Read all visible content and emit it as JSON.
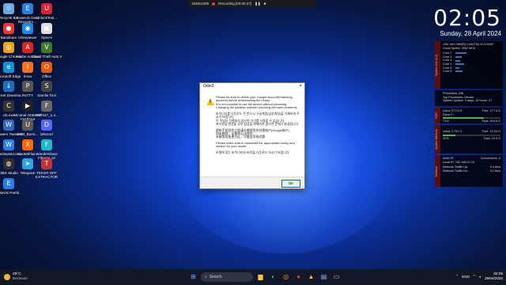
{
  "recording_bar": {
    "resolution": "1920x1080",
    "status": "Recording [00:00:47]"
  },
  "clock": {
    "time": "02:05",
    "date": "Sunday, 28 April 2024"
  },
  "desktop_icons": [
    {
      "label": "Recycle Bin",
      "icon": "recycle-bin-icon",
      "color": "#6aa8e0",
      "glyph": "♲"
    },
    {
      "label": "EaseUS Data Recovery ...",
      "icon": "easeus-icon",
      "color": "#2a7de1",
      "glyph": "E"
    },
    {
      "label": "UnlockTool...",
      "icon": "unlocktool-icon",
      "color": "#d23",
      "glyph": "U"
    },
    {
      "label": "Bandicam",
      "icon": "bandicam-icon",
      "color": "#e33",
      "glyph": "●"
    },
    {
      "label": "UltraViewer",
      "icon": "ultraviewer-icon",
      "color": "#1e88e5",
      "glyph": "◉"
    },
    {
      "label": "OpenV",
      "icon": "openv-icon",
      "color": "#ddd",
      "glyph": "▣"
    },
    {
      "label": "Google Chrome",
      "icon": "chrome-icon",
      "color": "#e9a21b",
      "glyph": "◎"
    },
    {
      "label": "Adobe Acrobat",
      "icon": "acrobat-icon",
      "color": "#d9221c",
      "glyph": "A"
    },
    {
      "label": "Grand Theft Auto V",
      "icon": "gta-icon",
      "color": "#3d7a2e",
      "glyph": "V"
    },
    {
      "label": "Microsoft Edge",
      "icon": "edge-icon",
      "color": "#1493d6",
      "glyph": "e"
    },
    {
      "label": "Imou",
      "icon": "imou-icon",
      "color": "#f36f21",
      "glyph": "i"
    },
    {
      "label": "Office",
      "icon": "office-icon",
      "color": "#e8590c",
      "glyph": "O"
    },
    {
      "label": "Internet Downloa...",
      "icon": "idm-icon",
      "color": "#1d6fb8",
      "glyph": "↓"
    },
    {
      "label": "PuTTY",
      "icon": "putty-icon",
      "color": "#555",
      "glyph": "P"
    },
    {
      "label": "Samfw Tool",
      "icon": "samfw-icon",
      "color": "#444",
      "glyph": "S"
    },
    {
      "label": "crk.exe",
      "icon": "crk-icon",
      "color": "#333",
      "glyph": "C"
    },
    {
      "label": "Minimal ADB and Fastboot",
      "icon": "adb-icon",
      "color": "#222",
      "glyph": "▶"
    },
    {
      "label": "FRP247_1.4...",
      "icon": "frp-icon",
      "color": "#666",
      "glyph": "F"
    },
    {
      "label": "Winaero Tweaker",
      "icon": "winaero-icon",
      "color": "#3568b8",
      "glyph": "W"
    },
    {
      "label": "USB_Burni...",
      "icon": "usb-icon",
      "color": "#5a5a5a",
      "glyph": "U"
    },
    {
      "label": "Discord",
      "icon": "discord-icon",
      "color": "#5865f2",
      "glyph": "D"
    },
    {
      "label": "windows64.exe",
      "icon": "windows-exe-icon",
      "color": "#2a7de1",
      "glyph": "W"
    },
    {
      "label": "XiaoMiFlas...",
      "icon": "xiaomi-icon",
      "color": "#ff6700",
      "glyph": "X"
    },
    {
      "label": "Wondershare Filmora 13",
      "icon": "filmora-icon",
      "color": "#1fb9c9",
      "glyph": "F"
    },
    {
      "label": "OBS Studio",
      "icon": "obs-icon",
      "color": "#302e31",
      "glyph": "◍"
    },
    {
      "label": "Telegram",
      "icon": "telegram-icon",
      "color": "#2aa3df",
      "glyph": "➤"
    },
    {
      "label": "TEKSR OFF EXTRACTOR",
      "icon": "teksr-icon",
      "color": "#b33",
      "glyph": "T"
    },
    {
      "label": "EaseUS Partiti...",
      "icon": "easeus-partition-icon",
      "color": "#2a7de1",
      "glyph": "E"
    }
  ],
  "system_panel": {
    "header_tab": "System Info (4.2)",
    "cpu_name": "12th Gen Intel(R) Core(TM) i5-12400F",
    "clock_speed": "Clock Speed: 2500 MHz",
    "cores": [
      "Core 1",
      "Core 2",
      "Core 3",
      "Core 4",
      "Core 5",
      "Core 6"
    ],
    "core_loads": [
      0.35,
      0.2,
      0.15,
      0.28,
      0.12,
      0.22
    ],
    "processes": "Processes: 236",
    "top_process": "Top Processes: Obcam",
    "uptime": "System Uptime: 0 days, 12 hours, 47",
    "disk_tab": "HDD",
    "disk_used": "Used: 377.6 G",
    "disk_free": "Free: 177.4 G",
    "disk_drive": "Drive C:",
    "disk_percent": "71%",
    "disk_total": "Total: 404.9 G",
    "memory_tab": "System Memory",
    "mem_used": "Used: 2.751 G",
    "mem_free": "Free: 12.24 G",
    "mem_percent": "22%",
    "mem_total": "Total: 15.9 G",
    "network_tab": "Network",
    "nic": "WAN IP:",
    "connections": "Connections: 0",
    "local_ip": "Local IP: 192.168.22.19",
    "traffic_up_label": "Network Traffic Up:",
    "traffic_up": "0.4 kb/s",
    "traffic_down_label": "Network Traffic Do...",
    "traffic_down": "0.1 kb/s"
  },
  "dialog": {
    "title": "Odin3",
    "close": "×",
    "paragraphs": [
      "Please be sure to delete your Google account(Samsung account) before downloading the binary.\nIt is not possible to use the device without unlocking.\nChanging the partition without unlocking will harm problems.",
      "바이너리를 다운로드 전 반드시 구글계정(삼성계정)을 삭제하여 주시기 바랍니다.\n이 작업이 진행되지 않으면 기기를 사용할 수 없습니다.\n파티션을 변경할 경우 잠금을 해제하지 않으면 문제가 발생합니다.",
      "更新手机固件之前请先删除您的谷歌账户(Google账户)\n如未删除，设备将无法使用\n未解锁而变更分区，可能会导致问题",
      "Please make sure to download the appropriate binary and version for your model",
      "모델에 맞는 바이너리와 버전을 다운로드 하시기 바랍니다."
    ],
    "ok_label": "OK"
  },
  "taskbar": {
    "temperature": "29°C",
    "weather": "Berawan",
    "search_placeholder": "Search",
    "apps": [
      "windows-start-icon",
      "file-explorer-icon",
      "edge-icon",
      "chrome-icon",
      "bandicam-icon",
      "odin-icon",
      "store-icon",
      "terminal-icon"
    ],
    "lang": "ENG",
    "time": "02:05",
    "date": "28/04/2024"
  }
}
